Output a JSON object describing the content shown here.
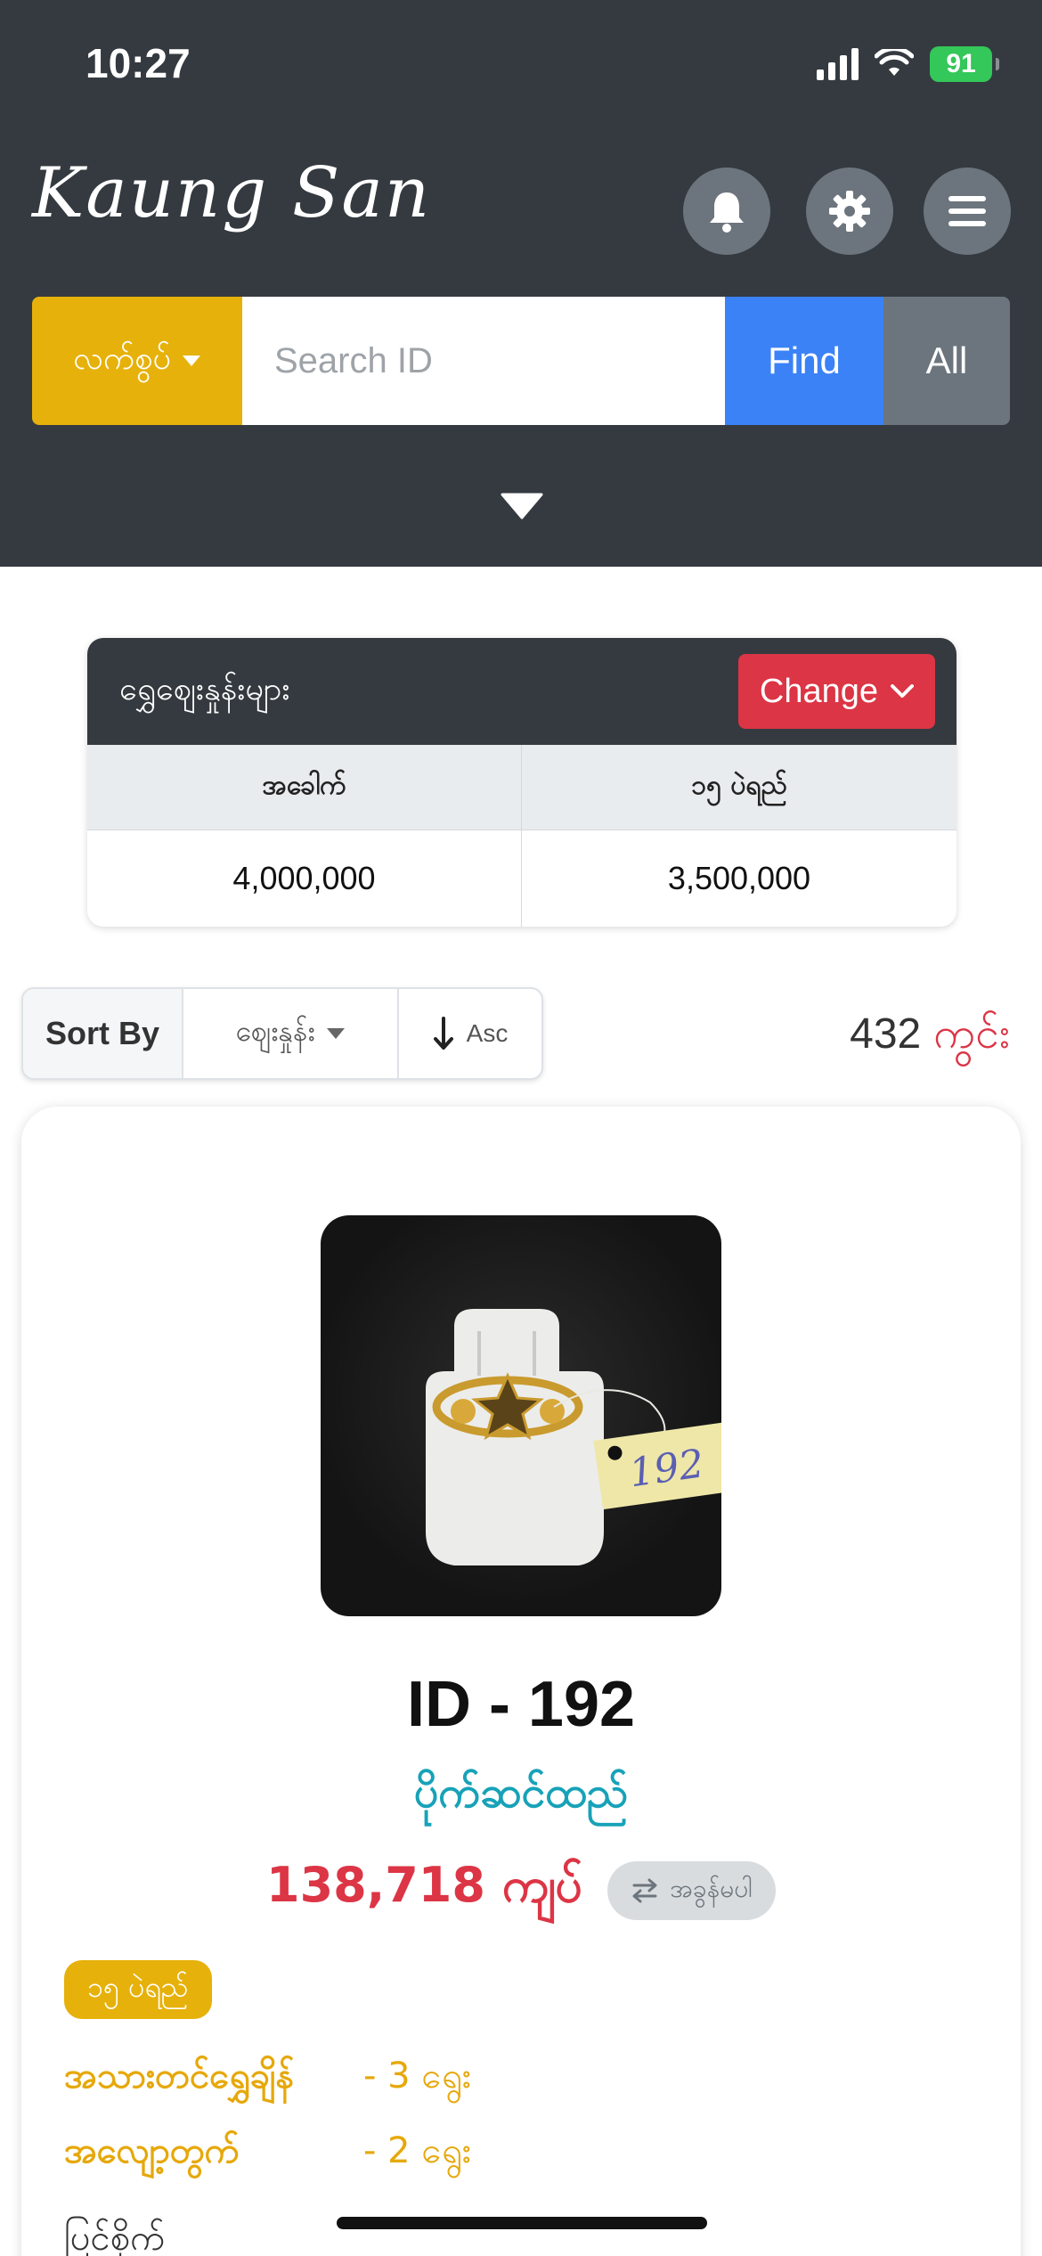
{
  "status_bar": {
    "time": "10:27",
    "battery": "91"
  },
  "header": {
    "logo": "Kaung San",
    "category_label": "လက်စွပ်",
    "search_placeholder": "Search ID",
    "find_label": "Find",
    "all_label": "All"
  },
  "gold_price": {
    "title": "ရွှေဈေးနှုန်းများ",
    "change_label": "Change",
    "columns": [
      "အခေါက်",
      "၁၅ ပဲရည်"
    ],
    "values": [
      "4,000,000",
      "3,500,000"
    ]
  },
  "sort": {
    "label": "Sort By",
    "field": "ဈေးနှုန်း",
    "direction": "Asc",
    "count": "432",
    "count_unit": "ကွင်း"
  },
  "product": {
    "id_text": "ID - 192",
    "tag_text": "192",
    "type": "ပိုက်ဆင်ထည်",
    "price": "138,718 ကျပ်",
    "exchange": "အခွန်မပါ",
    "karat": "၁၅ ပဲရည်",
    "specs": [
      {
        "label": "အသားတင်ရွှေချိန်",
        "value": "- 3 ရွေး"
      },
      {
        "label": "အလျော့တွက်",
        "value": "- 2 ရွေး"
      }
    ],
    "cut_text": "ပြင်စိုက်"
  },
  "colors": {
    "header_bg": "#343a40",
    "accent_yellow": "#e6b10a",
    "find_blue": "#3b82f6",
    "danger_red": "#dc3545",
    "info_teal": "#17a2b8"
  }
}
